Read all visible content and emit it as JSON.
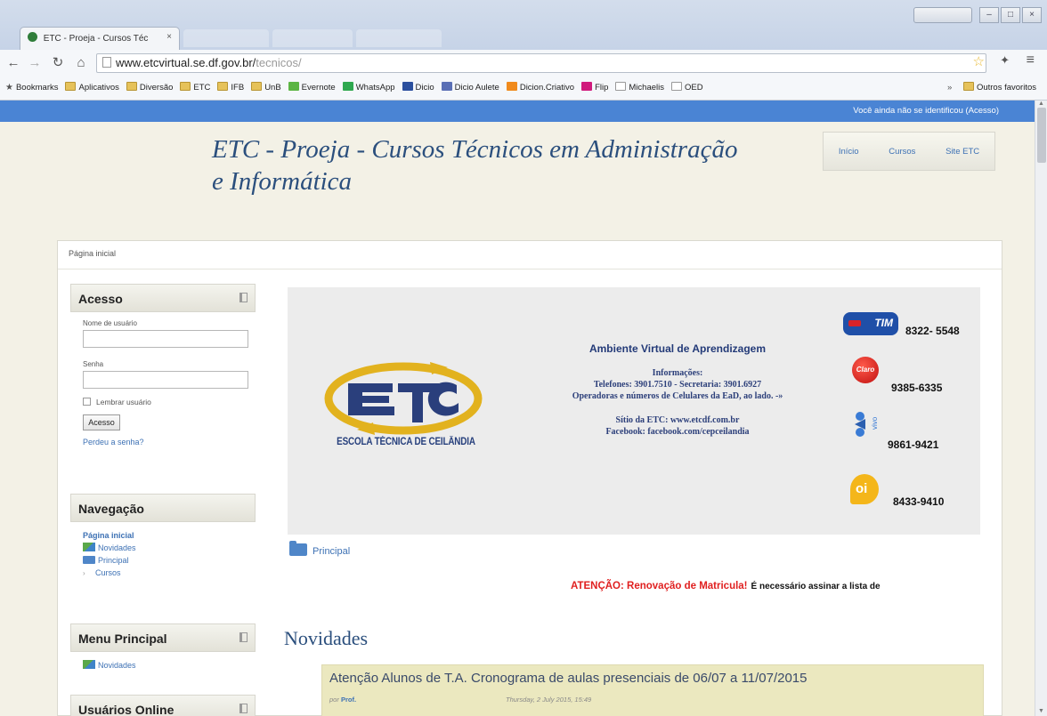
{
  "browser": {
    "tab_title": "ETC - Proeja - Cursos Téc",
    "tab_close": "×",
    "url_host": "www.etcvirtual.se.df.gov.br/",
    "url_path": "tecnicos/",
    "bookmarks": [
      {
        "label": "Bookmarks",
        "icon": "star-icon"
      },
      {
        "label": "Aplicativos",
        "icon": "folder-icon"
      },
      {
        "label": "Diversão",
        "icon": "folder-icon"
      },
      {
        "label": "ETC",
        "icon": "folder-icon"
      },
      {
        "label": "IFB",
        "icon": "folder-icon"
      },
      {
        "label": "UnB",
        "icon": "folder-icon"
      },
      {
        "label": "Evernote",
        "icon": "evernote-icon"
      },
      {
        "label": "WhatsApp",
        "icon": "whatsapp-icon"
      },
      {
        "label": "Dicio",
        "icon": "book-icon"
      },
      {
        "label": "Dicio Aulete",
        "icon": "aulete-icon"
      },
      {
        "label": "Dicion.Criativo",
        "icon": "criativo-icon"
      },
      {
        "label": "Flip",
        "icon": "flip-icon"
      },
      {
        "label": "Michaelis",
        "icon": "page-icon"
      },
      {
        "label": "OED",
        "icon": "page-icon"
      }
    ],
    "bookmarks_overflow": "»",
    "other_bookmarks": "Outros favoritos"
  },
  "page": {
    "login_status": "Você ainda não se identificou (Acesso)",
    "site_title": "ETC - Proeja - Cursos Técnicos em Administração e Informática",
    "site_nav": [
      "Início",
      "Cursos",
      "Site ETC"
    ],
    "breadcrumb": "Página inicial"
  },
  "login_block": {
    "title": "Acesso",
    "username_label": "Nome de usuário",
    "password_label": "Senha",
    "remember_label": "Lembrar usuário",
    "submit_label": "Acesso",
    "forgot_link": "Perdeu a senha?"
  },
  "navigation_block": {
    "title": "Navegação",
    "home": "Página inicial",
    "items": [
      "Novidades",
      "Principal",
      "Cursos"
    ]
  },
  "main_menu_block": {
    "title": "Menu Principal",
    "items": [
      "Novidades"
    ]
  },
  "online_block": {
    "title": "Usuários Online"
  },
  "banner": {
    "school_name": "ESCOLA TÉCNICA DE CEILÂNDIA",
    "heading": "Ambiente Virtual de Aprendizagem",
    "info_label": "Informações:",
    "phones": "Telefones: 3901.7510 - Secretaria: 3901.6927",
    "operators_note": "Operadoras e números de Celulares da EaD, ao lado. -»",
    "site": "Sítio da ETC: www.etcdf.com.br",
    "facebook": "Facebook: facebook.com/cepceilandia",
    "carriers": [
      {
        "logo": "TIM",
        "number": "8322- 5548"
      },
      {
        "logo": "Claro",
        "number": "9385-6335"
      },
      {
        "logo": "vivo",
        "number": "9861-9421"
      },
      {
        "logo": "oi",
        "number": "8433-9410"
      }
    ]
  },
  "main": {
    "section_link": "Principal",
    "marquee_warning": "ATENÇÃO: Renovação de Matricula!",
    "marquee_rest": "É necessário assinar a lista de",
    "news_heading": "Novidades",
    "post": {
      "title": "Atenção Alunos de T.A. Cronograma de aulas presenciais de 06/07 a 11/07/2015",
      "author_prefix": "por",
      "author": "Prof.",
      "date": "Thursday, 2 July 2015, 15:49"
    }
  },
  "colors": {
    "topbar": "#4a84d4",
    "title": "#2b4f7d",
    "link": "#3d71b4",
    "warning": "#e02020",
    "post_bg": "#ebe8bf"
  }
}
